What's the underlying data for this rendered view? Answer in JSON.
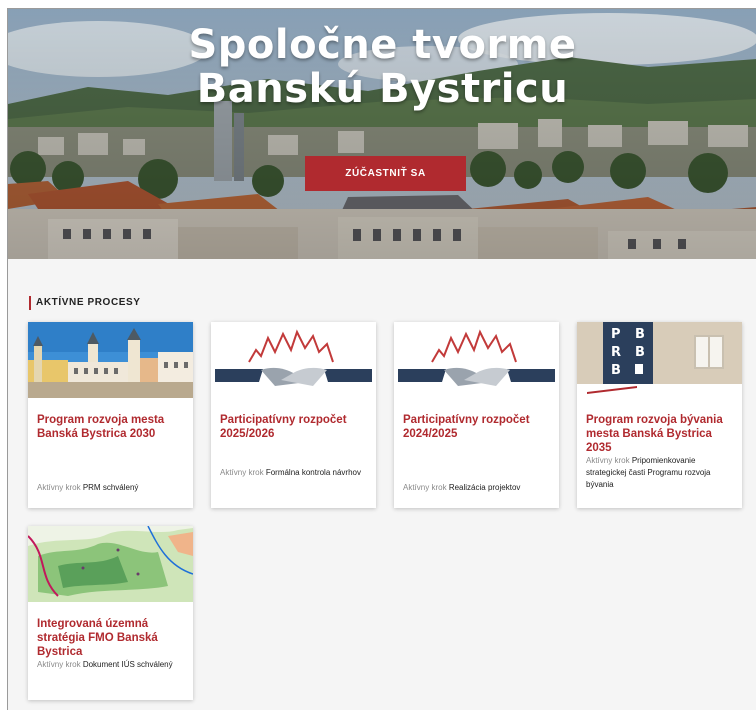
{
  "hero": {
    "title_line1": "Spoločne tvorme",
    "title_line2": "Banskú Bystricu",
    "cta_label": "ZÚČASTNIŤ SA"
  },
  "section": {
    "heading": "AKTÍVNE PROCESY"
  },
  "cards": [
    {
      "title": "Program rozvoja mesta Banská Bystrica 2030",
      "step_label": "Aktívny krok",
      "step_value": "PRM schválený"
    },
    {
      "title": "Participatívny rozpočet 2025/2026",
      "step_label": "Aktívny krok",
      "step_value": "Formálna kontrola návrhov"
    },
    {
      "title": "Participatívny rozpočet 2024/2025",
      "step_label": "Aktívny krok",
      "step_value": "Realizácia projektov"
    },
    {
      "title": "Program rozvoja bývania mesta Banská Bystrica 2035",
      "step_label": "Aktívny krok",
      "step_value": "Pripomienkovanie strategickej časti Programu rozvoja bývania"
    },
    {
      "title": "Integrovaná územná stratégia FMO Banská Bystrica",
      "step_label": "Aktívny krok",
      "step_value": "Dokument IÚS schválený"
    }
  ],
  "pbb_logo": [
    "P",
    "B",
    "R",
    "B",
    "B"
  ],
  "colors": {
    "accent": "#b02a2f",
    "navy": "#2b3f5c",
    "page_bg": "#f5f5f5"
  }
}
